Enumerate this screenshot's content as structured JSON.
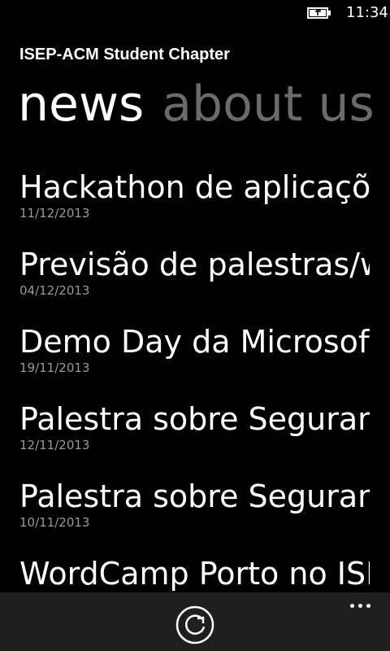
{
  "status_bar": {
    "time": "11:34",
    "battery_icon": "battery-charging-icon"
  },
  "app": {
    "title": "ISEP-ACM Student Chapter"
  },
  "pivot": {
    "tabs": [
      {
        "label": "news",
        "active": true
      },
      {
        "label": "about us",
        "active": false
      }
    ]
  },
  "news": {
    "items": [
      {
        "title": "Hackathon de aplicações",
        "date": "11/12/2013"
      },
      {
        "title": "Previsão de palestras/workshops",
        "date": "04/12/2013"
      },
      {
        "title": "Demo Day da Microsoft",
        "date": "19/11/2013"
      },
      {
        "title": "Palestra sobre Segurança",
        "date": "12/11/2013"
      },
      {
        "title": "Palestra sobre Segurança",
        "date": "10/11/2013"
      },
      {
        "title": "WordCamp Porto no ISEP",
        "date": ""
      }
    ]
  },
  "app_bar": {
    "refresh_icon": "refresh-icon",
    "more_icon": "more-ellipsis-icon"
  },
  "colors": {
    "background": "#000000",
    "foreground": "#ffffff",
    "inactive_header": "#6b6b6b",
    "date_text": "#9a9a9a",
    "app_bar": "#1f1f1f"
  }
}
